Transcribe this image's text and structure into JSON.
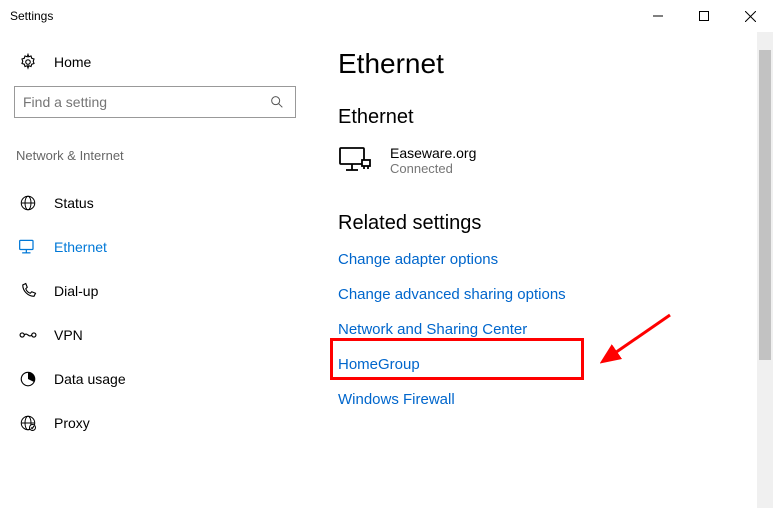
{
  "window": {
    "title": "Settings"
  },
  "sidebar": {
    "home": "Home",
    "search_placeholder": "Find a setting",
    "category": "Network & Internet",
    "items": [
      {
        "label": "Status"
      },
      {
        "label": "Ethernet"
      },
      {
        "label": "Dial-up"
      },
      {
        "label": "VPN"
      },
      {
        "label": "Data usage"
      },
      {
        "label": "Proxy"
      }
    ]
  },
  "main": {
    "title": "Ethernet",
    "section": "Ethernet",
    "connection": {
      "name": "Easeware.org",
      "status": "Connected"
    },
    "related_title": "Related settings",
    "links": [
      "Change adapter options",
      "Change advanced sharing options",
      "Network and Sharing Center",
      "HomeGroup",
      "Windows Firewall"
    ]
  }
}
